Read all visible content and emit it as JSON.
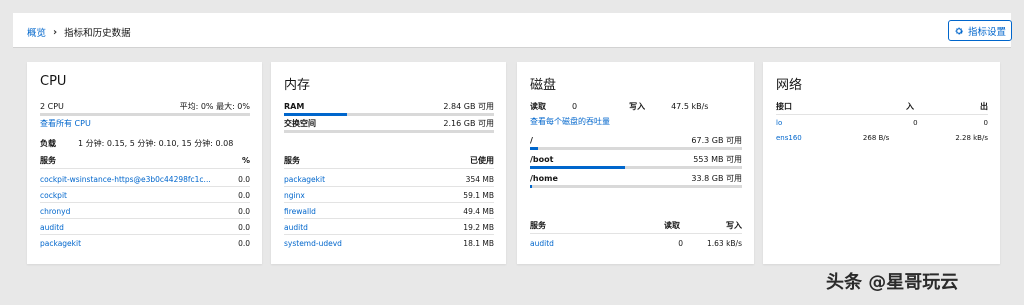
{
  "header": {
    "breadcrumb_root": "概览",
    "breadcrumb_current": "指标和历史数据",
    "metrics_button": "指标设置"
  },
  "cpu": {
    "title": "CPU",
    "cores": "2 CPU",
    "avg_max": "平均: 0% 最大: 0%",
    "usage_fraction": 0.0,
    "view_all": "查看所有 CPU",
    "load_label": "负载",
    "load_value": "1 分钟: 0.15, 5 分钟: 0.10, 15 分钟: 0.08",
    "service_header": "服务",
    "percent_header": "%",
    "services": [
      {
        "name": "cockpit-wsinstance-https@e3b0c44298fc1c...",
        "value": "0.0"
      },
      {
        "name": "cockpit",
        "value": "0.0"
      },
      {
        "name": "chronyd",
        "value": "0.0"
      },
      {
        "name": "auditd",
        "value": "0.0"
      },
      {
        "name": "packagekit",
        "value": "0.0"
      }
    ]
  },
  "memory": {
    "title": "内存",
    "ram_label": "RAM",
    "ram_value": "2.84 GB 可用",
    "ram_fraction": 0.3,
    "swap_label": "交换空间",
    "swap_value": "2.16 GB 可用",
    "swap_fraction": 0.0,
    "service_header": "服务",
    "used_header": "已使用",
    "services": [
      {
        "name": "packagekit",
        "value": "354 MB"
      },
      {
        "name": "nginx",
        "value": "59.1 MB"
      },
      {
        "name": "firewalld",
        "value": "49.4 MB"
      },
      {
        "name": "auditd",
        "value": "19.2 MB"
      },
      {
        "name": "systemd-udevd",
        "value": "18.1 MB"
      }
    ]
  },
  "disk": {
    "title": "磁盘",
    "read_label": "读取",
    "read_value": "0",
    "write_label": "写入",
    "write_value": "47.5 kB/s",
    "per_disk_link": "查看每个磁盘的吞吐量",
    "mounts": [
      {
        "path": "/",
        "value": "67.3 GB 可用",
        "fraction": 0.04
      },
      {
        "path": "/boot",
        "value": "553 MB 可用",
        "fraction": 0.45
      },
      {
        "path": "/home",
        "value": "33.8 GB 可用",
        "fraction": 0.01
      }
    ],
    "service_header": "服务",
    "read_header": "读取",
    "write_header": "写入",
    "services": [
      {
        "name": "auditd",
        "read": "0",
        "write": "1.63 kB/s"
      }
    ]
  },
  "network": {
    "title": "网络",
    "iface_header": "接口",
    "in_header": "入",
    "out_header": "出",
    "interfaces": [
      {
        "name": "lo",
        "in": "0",
        "out": "0"
      },
      {
        "name": "ens160",
        "in": "268 B/s",
        "out": "2.28 kB/s"
      }
    ]
  },
  "watermark": "头条 @星哥玩云",
  "colors": {
    "accent": "#0066cc",
    "track": "#d9d9d9"
  }
}
